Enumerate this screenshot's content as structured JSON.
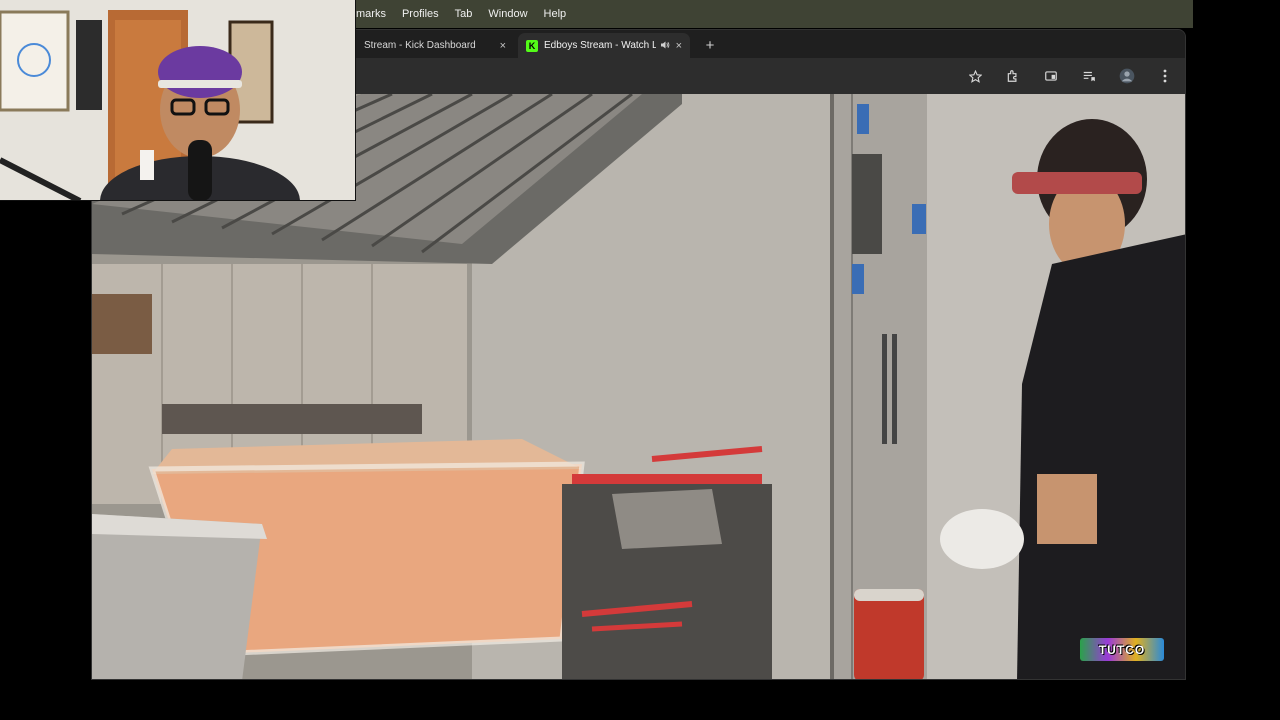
{
  "menubar": {
    "items": [
      {
        "label": "marks"
      },
      {
        "label": "Profiles"
      },
      {
        "label": "Tab"
      },
      {
        "label": "Window"
      },
      {
        "label": "Help"
      }
    ]
  },
  "browser": {
    "tabs": [
      {
        "title": "Stream - Kick Dashboard",
        "close": "×"
      },
      {
        "title": "Edboys Stream - Watch L",
        "close": "×",
        "favicon": "K"
      }
    ],
    "new_tab": "+"
  },
  "toolbar": {
    "icons": [
      "star-icon",
      "extensions-icon",
      "tab-search-icon",
      "reading-list-icon",
      "profile-avatar",
      "more-menu-icon"
    ]
  },
  "video": {
    "watermark": "TUTCO"
  },
  "colors": {
    "menubar_bg": "#3f4334",
    "browser_bg": "#1f1f1f",
    "toolbar_bg": "#2d2d2d",
    "kick_green": "#53fc18"
  }
}
